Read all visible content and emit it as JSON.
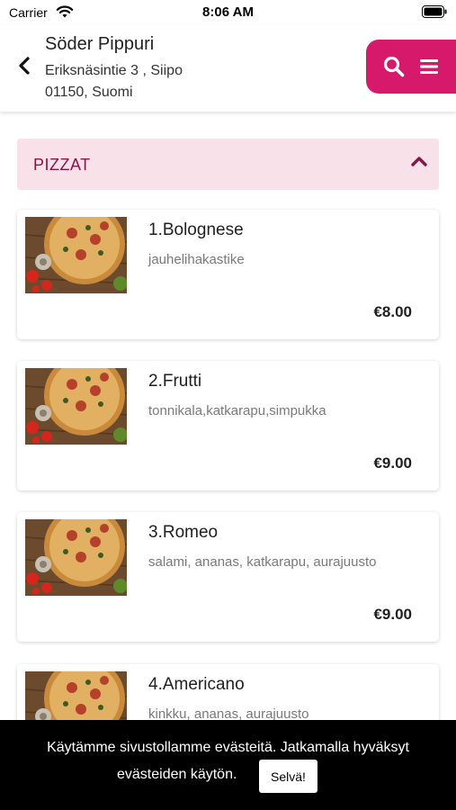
{
  "status_bar": {
    "carrier": "Carrier",
    "time": "8:06 AM"
  },
  "header": {
    "name": "Söder Pippuri",
    "address_line1": "Eriksnäsintie 3 , Siipo",
    "address_line2": "01150, Suomi",
    "icons": [
      "chevron-left-icon",
      "search-icon",
      "menu-icon"
    ],
    "accent_color": "#d6196b"
  },
  "category": {
    "title": "PIZZAT",
    "expanded": true,
    "background_color": "#f9e1ea"
  },
  "products": [
    {
      "name": "1.Bolognese",
      "description": "jauhelihakastike",
      "price": "€8.00"
    },
    {
      "name": "2.Frutti",
      "description": "tonnikala,katkarapu,simpukka",
      "price": "€9.00"
    },
    {
      "name": "3.Romeo",
      "description": "salami, ananas, katkarapu, aurajuusto",
      "price": "€9.00"
    },
    {
      "name": "4.Americano",
      "description": "kinkku, ananas, aurajuusto",
      "price": ""
    }
  ],
  "cookie_banner": {
    "line1": "Käytämme sivustollamme evästeitä. Jatkamalla hyväksyt",
    "line2": "evästeiden käytön.",
    "button_label": "Selvä!"
  }
}
